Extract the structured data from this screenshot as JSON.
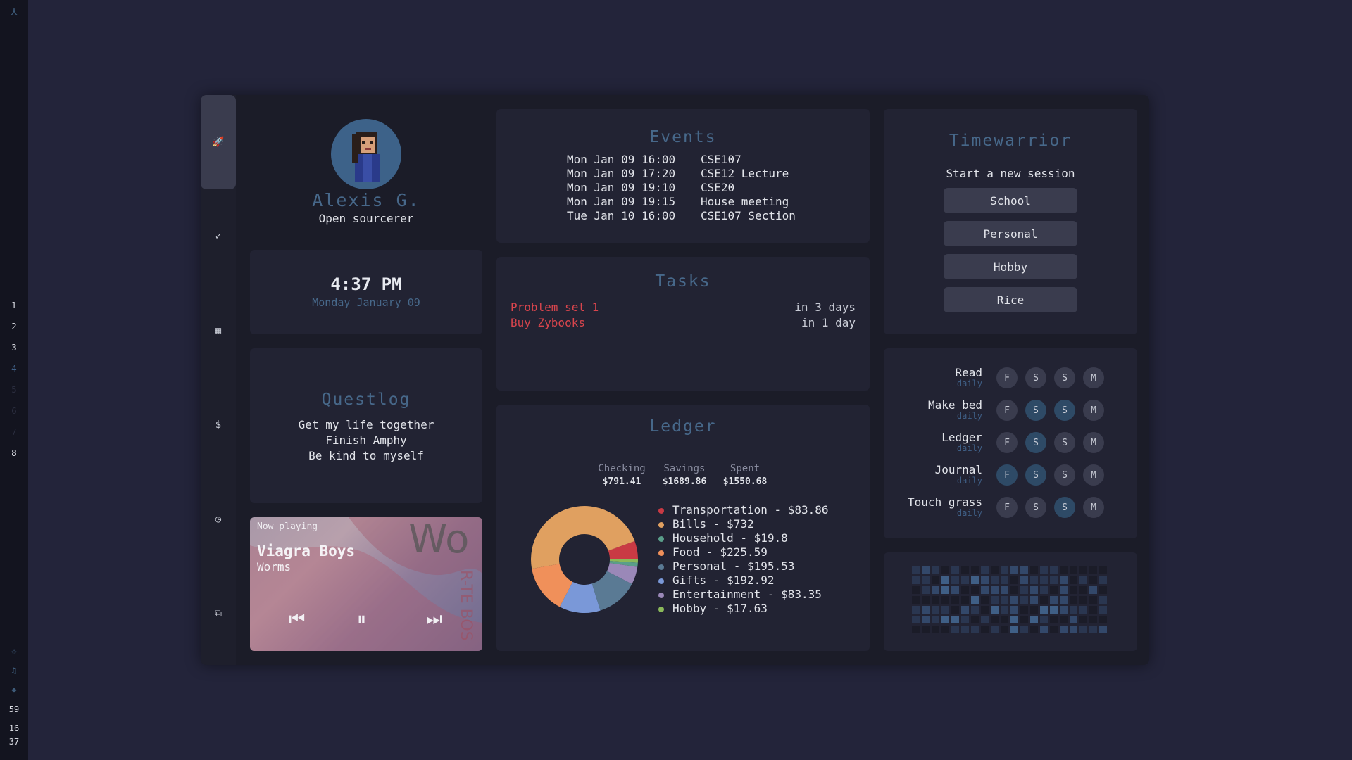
{
  "bar": {
    "logo": "⋏",
    "workspaces": [
      "1",
      "2",
      "3",
      "4",
      "5",
      "6",
      "7",
      "8"
    ],
    "tray": {
      "clock_min": "59",
      "clock_h": "16",
      "clock_m2": "37"
    }
  },
  "side_buttons": [
    {
      "name": "rocket-icon",
      "glyph": "🚀"
    },
    {
      "name": "check-icon",
      "glyph": "✓"
    },
    {
      "name": "calendar-icon",
      "glyph": "▦"
    },
    {
      "name": "dollar-icon",
      "glyph": "$"
    },
    {
      "name": "clock-icon",
      "glyph": "◷"
    },
    {
      "name": "copy-icon",
      "glyph": "⧉"
    }
  ],
  "profile": {
    "name": "Alexis G.",
    "subtitle": "Open sourcerer"
  },
  "clock": {
    "time": "4:37 PM",
    "date": "Monday January 09"
  },
  "questlog": {
    "title": "Questlog",
    "items": [
      "Get my life together",
      "Finish Amphy",
      "Be kind to myself"
    ]
  },
  "player": {
    "label": "Now playing",
    "artist": "Viagra Boys",
    "song": "Worms",
    "prev": "⏮",
    "pause": "⏸",
    "next": "⏭"
  },
  "events": {
    "title": "Events",
    "items": [
      {
        "when": "Mon Jan 09 16:00",
        "what": "CSE107"
      },
      {
        "when": "Mon Jan 09 17:20",
        "what": "CSE12 Lecture"
      },
      {
        "when": "Mon Jan 09 19:10",
        "what": "CSE20"
      },
      {
        "when": "Mon Jan 09 19:15",
        "what": "House meeting"
      },
      {
        "when": "Tue Jan 10 16:00",
        "what": "CSE107 Section"
      }
    ]
  },
  "tasks": {
    "title": "Tasks",
    "items": [
      {
        "name": "Problem set 1",
        "due": "in 3 days"
      },
      {
        "name": "Buy Zybooks",
        "due": "in 1 day"
      }
    ]
  },
  "ledger": {
    "title": "Ledger",
    "accounts": [
      {
        "label": "Checking",
        "value": "$791.41"
      },
      {
        "label": "Savings",
        "value": "$1689.86"
      },
      {
        "label": "Spent",
        "value": "$1550.68"
      }
    ]
  },
  "chart_data": {
    "type": "pie",
    "donut": true,
    "categories": [
      "Transportation",
      "Bills",
      "Household",
      "Food",
      "Personal",
      "Gifts",
      "Entertainment",
      "Hobby"
    ],
    "values": [
      83.86,
      732,
      19.8,
      225.59,
      195.53,
      192.92,
      83.35,
      17.63
    ],
    "labels": [
      "Transportation - $83.86",
      "Bills - $732",
      "Household - $19.8",
      "Food - $225.59",
      "Personal - $195.53",
      "Gifts - $192.92",
      "Entertainment - $83.35",
      "Hobby - $17.63"
    ],
    "colors": [
      "#c93a44",
      "#e0a060",
      "#5a9e8a",
      "#f0905a",
      "#5a7a94",
      "#7a98d8",
      "#9a88b8",
      "#8ab85a"
    ]
  },
  "timewarrior": {
    "title": "Timewarrior",
    "prompt": "Start a new session",
    "buttons": [
      "School",
      "Personal",
      "Hobby",
      "Rice"
    ]
  },
  "habits": {
    "days": [
      "F",
      "S",
      "S",
      "M"
    ],
    "items": [
      {
        "name": "Read",
        "freq": "daily",
        "done": [
          false,
          false,
          false,
          false
        ]
      },
      {
        "name": "Make bed",
        "freq": "daily",
        "done": [
          false,
          true,
          true,
          false
        ]
      },
      {
        "name": "Ledger",
        "freq": "daily",
        "done": [
          false,
          true,
          false,
          false
        ]
      },
      {
        "name": "Journal",
        "freq": "daily",
        "done": [
          true,
          true,
          false,
          false
        ]
      },
      {
        "name": "Touch grass",
        "freq": "daily",
        "done": [
          false,
          false,
          true,
          false
        ]
      }
    ]
  },
  "heatmap": {
    "colors": {
      "empty": "#1b1c28",
      "low": "#2a3650",
      "mid": "#33486a",
      "high": "#3f5f86"
    }
  }
}
